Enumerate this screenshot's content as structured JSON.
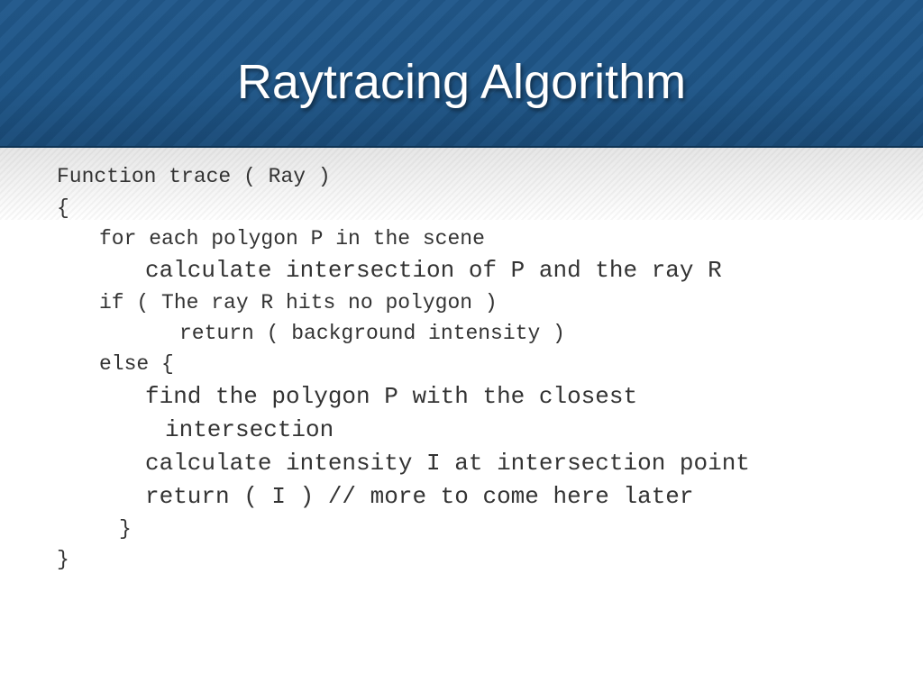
{
  "slide": {
    "title": "Raytracing Algorithm",
    "code_lines": [
      "Function trace ( Ray )",
      "{",
      "for each polygon P in the scene",
      "calculate intersection of P and the ray R",
      "if ( The ray R hits no polygon )",
      "return ( background intensity )",
      "else {",
      "find the polygon P with the closest",
      "intersection",
      "calculate intensity I at intersection point",
      "return ( I ) // more to come here later",
      "}",
      "}"
    ]
  }
}
